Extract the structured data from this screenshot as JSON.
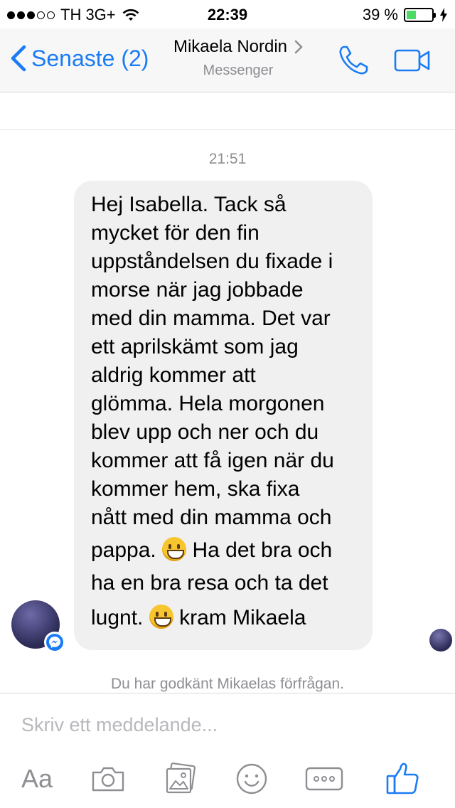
{
  "status_bar": {
    "carrier": "TH 3G+",
    "time": "22:39",
    "battery_percent": "39 %",
    "signal_bars_filled": 3,
    "signal_bars_total": 5,
    "battery_level": 0.39
  },
  "nav": {
    "back_label": "Senaste (2)",
    "contact_name": "Mikaela Nordin",
    "subtitle": "Messenger"
  },
  "conversation": {
    "timestamp": "21:51",
    "message_lines": [
      "Hej Isabella. Tack så",
      "mycket för den fin",
      "uppståndelsen du fixade i",
      "morse när jag jobbade",
      "med din mamma. Det var",
      "ett aprilskämt som jag",
      "aldrig kommer att",
      "glömma. Hela morgonen",
      "blev upp och ner och du",
      "kommer att få igen när du",
      "kommer hem, ska fixa",
      "nått med din mamma och"
    ],
    "line_13_before": "pappa.",
    "line_13_after": "Ha det bra och",
    "line_14": "ha en bra resa och ta det",
    "line_15_before": "lugnt.",
    "line_15_after": "kram Mikaela",
    "notice": "Du har godkänt Mikaelas förfrågan."
  },
  "composer": {
    "placeholder": "Skriv ett meddelande...",
    "value": "",
    "aa_label": "Aa"
  },
  "colors": {
    "accent": "#1a7cf5",
    "bubble": "#f1f0f0",
    "muted": "#8e8e93",
    "battery": "#4cd964"
  }
}
